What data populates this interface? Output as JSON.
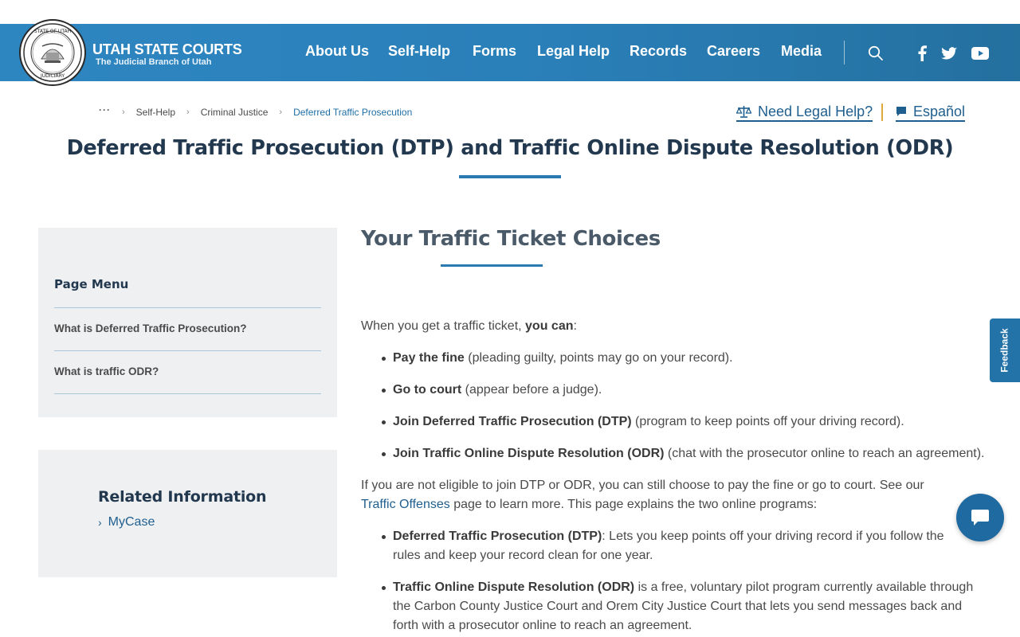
{
  "header": {
    "brand_title": "UTAH STATE COURTS",
    "brand_subtitle": "The Judicial Branch of Utah",
    "seal_text_top": "STATE OF UTAH",
    "seal_text_bottom": "JUDICIARY",
    "nav": [
      "About Us",
      "Self-Help",
      "Forms",
      "Legal Help",
      "Records",
      "Careers",
      "Media"
    ],
    "icons": [
      "search-icon",
      "facebook-icon",
      "twitter-icon",
      "youtube-icon"
    ],
    "accent_color": "#2b7ab2"
  },
  "breadcrumb": {
    "ellipsis": "···",
    "items": [
      "Self-Help",
      "Criminal Justice",
      "Deferred Traffic Prosecution"
    ]
  },
  "utility": {
    "legal_help": "Need Legal Help?",
    "spanish": "Español"
  },
  "page": {
    "title": "Deferred Traffic Prosecution (DTP) and Traffic Online Dispute Resolution (ODR)"
  },
  "sidebar": {
    "menu_heading": "Page Menu",
    "menu_items": [
      "What is Deferred Traffic Prosecution?",
      "What is traffic ODR?"
    ],
    "related_heading": "Related Information",
    "related_links": [
      "MyCase"
    ]
  },
  "main": {
    "section_title": "Your Traffic Ticket Choices",
    "intro_pre": "When you get a traffic ticket, ",
    "intro_bold": "you can",
    "intro_post": ":",
    "choices": [
      {
        "bold": "Pay the fine",
        "text": " (pleading guilty, points may go on your record)."
      },
      {
        "bold": "Go to court",
        "text": " (appear before a judge)."
      },
      {
        "bold": "Join Deferred Traffic Prosecution (DTP)",
        "text": " (program to keep points off your driving record)."
      },
      {
        "bold": "Join Traffic Online Dispute Resolution (ODR)",
        "text": " (chat with the prosecutor online to reach an agreement)."
      }
    ],
    "eligibility_pre": "If you are not eligible to join DTP or ODR, you can still choose to pay the fine or go to court. See our ",
    "eligibility_link": "Traffic Offenses",
    "eligibility_post": " page to learn more. This page explains the two online programs:",
    "programs": [
      {
        "bold": "Deferred Traffic Prosecution (DTP)",
        "text": ": Lets you keep points off your driving record if you follow the rules and keep your record clean for one year."
      },
      {
        "bold": "Traffic Online Dispute Resolution (ODR)",
        "text": " is a free, voluntary pilot program currently available through the Carbon County Justice Court and Orem City Justice Court that lets you send messages back and forth with a prosecutor online to reach an agreement."
      }
    ]
  },
  "widgets": {
    "feedback": "Feedback"
  }
}
